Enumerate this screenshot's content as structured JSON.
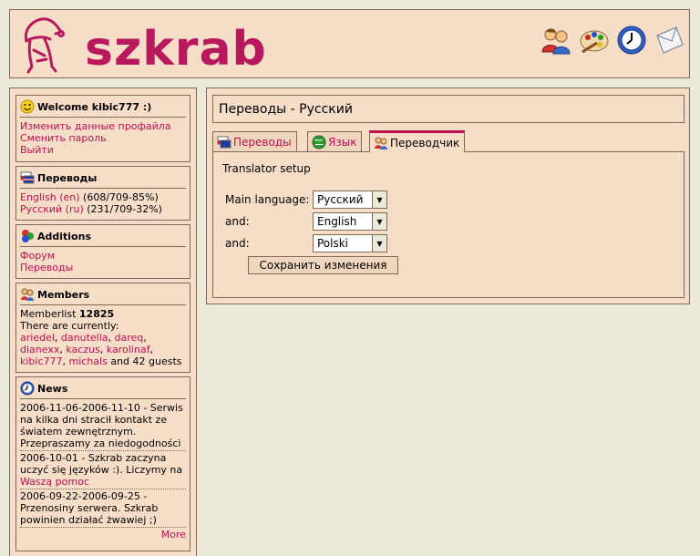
{
  "header": {
    "logo_text": "szkrab",
    "icons": [
      "users-icon",
      "palette-icon",
      "clock-icon",
      "envelope-icon"
    ]
  },
  "sidebar": {
    "welcome": {
      "title": "Welcome kibic777 :)",
      "links": [
        "Изменить данные профайла",
        "Сменить пароль",
        "Выйти"
      ]
    },
    "translations": {
      "title": "Переводы",
      "items": [
        {
          "link": "English (en)",
          "stat": "(608/709-85%)"
        },
        {
          "link": "Русский (ru)",
          "stat": "(231/709-32%)"
        }
      ]
    },
    "additions": {
      "title": "Additions",
      "links": [
        "Форум",
        "Переводы"
      ]
    },
    "members": {
      "title": "Members",
      "memberlist_label": "Memberlist",
      "memberlist_count": "12825",
      "currently": "There are currently:",
      "users": [
        "ariedel",
        "danutella",
        "dareq",
        "dianexx",
        "kaczus",
        "karolinaf",
        "kibic777",
        "michals"
      ],
      "guests_text": "and 42 guests"
    },
    "news": {
      "title": "News",
      "items": [
        {
          "text": "2006-11-06-2006-11-10 - Serwis na kilka dni stracił kontakt ze światem zewnętrznym. Przepraszamy za niedogodności",
          "link": ""
        },
        {
          "text": "2006-10-01 - Szkrab zaczyna uczyć się języków :). Liczymy na",
          "link": "Waszą pomoc"
        },
        {
          "text": "2006-09-22-2006-09-25 - Przenosiny serwera. Szkrab powinien działać żwawiej ;)",
          "link": ""
        }
      ],
      "more": "More"
    }
  },
  "main": {
    "title": "Переводы - Русский",
    "tabs": [
      "Переводы",
      "Язык",
      "Переводчик"
    ],
    "active_tab": 2,
    "panel": {
      "heading": "Translator setup",
      "rows": [
        {
          "label": "Main language:",
          "value": "Русский"
        },
        {
          "label": "and:",
          "value": "English"
        },
        {
          "label": "and:",
          "value": "Polski"
        }
      ],
      "save_label": "Сохранить изменения"
    }
  },
  "colors": {
    "background": "#ECE9D8",
    "panel": "#F6DDC8",
    "border": "#7A6A5A",
    "link": "#C01050",
    "logo": "#B8185C"
  }
}
